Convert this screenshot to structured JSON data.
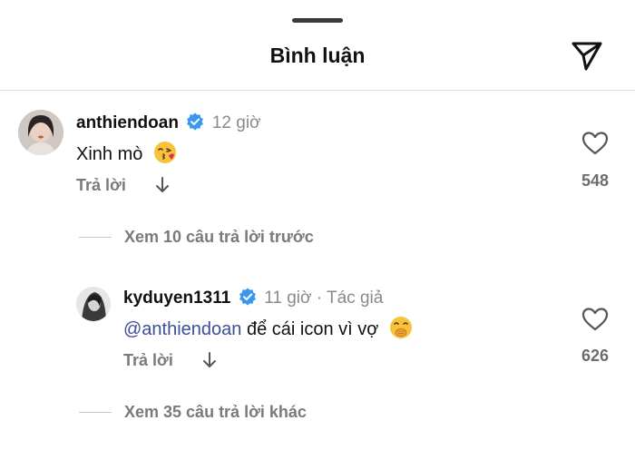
{
  "header": {
    "title": "Bình luận"
  },
  "comments": [
    {
      "username": "anthiendoan",
      "time": "12 giờ",
      "text": "Xinh mò",
      "reply_label": "Trả lời",
      "likes": "548"
    }
  ],
  "view_previous": "Xem 10 câu trả lời trước",
  "replies": [
    {
      "username": "kyduyen1311",
      "time": "11 giờ · Tác giả",
      "mention": "@anthiendoan",
      "text": "để cái icon vì vợ",
      "reply_label": "Trả lời",
      "likes": "626"
    }
  ],
  "view_more": "Xem 35 câu trả lời khác",
  "colors": {
    "mention": "#3b4f9a",
    "verified": "#3897f0"
  },
  "icons": [
    "send-icon",
    "verified-icon",
    "heart-icon",
    "arrow-down-icon",
    "kissing-emoji",
    "hand-over-mouth-emoji"
  ]
}
